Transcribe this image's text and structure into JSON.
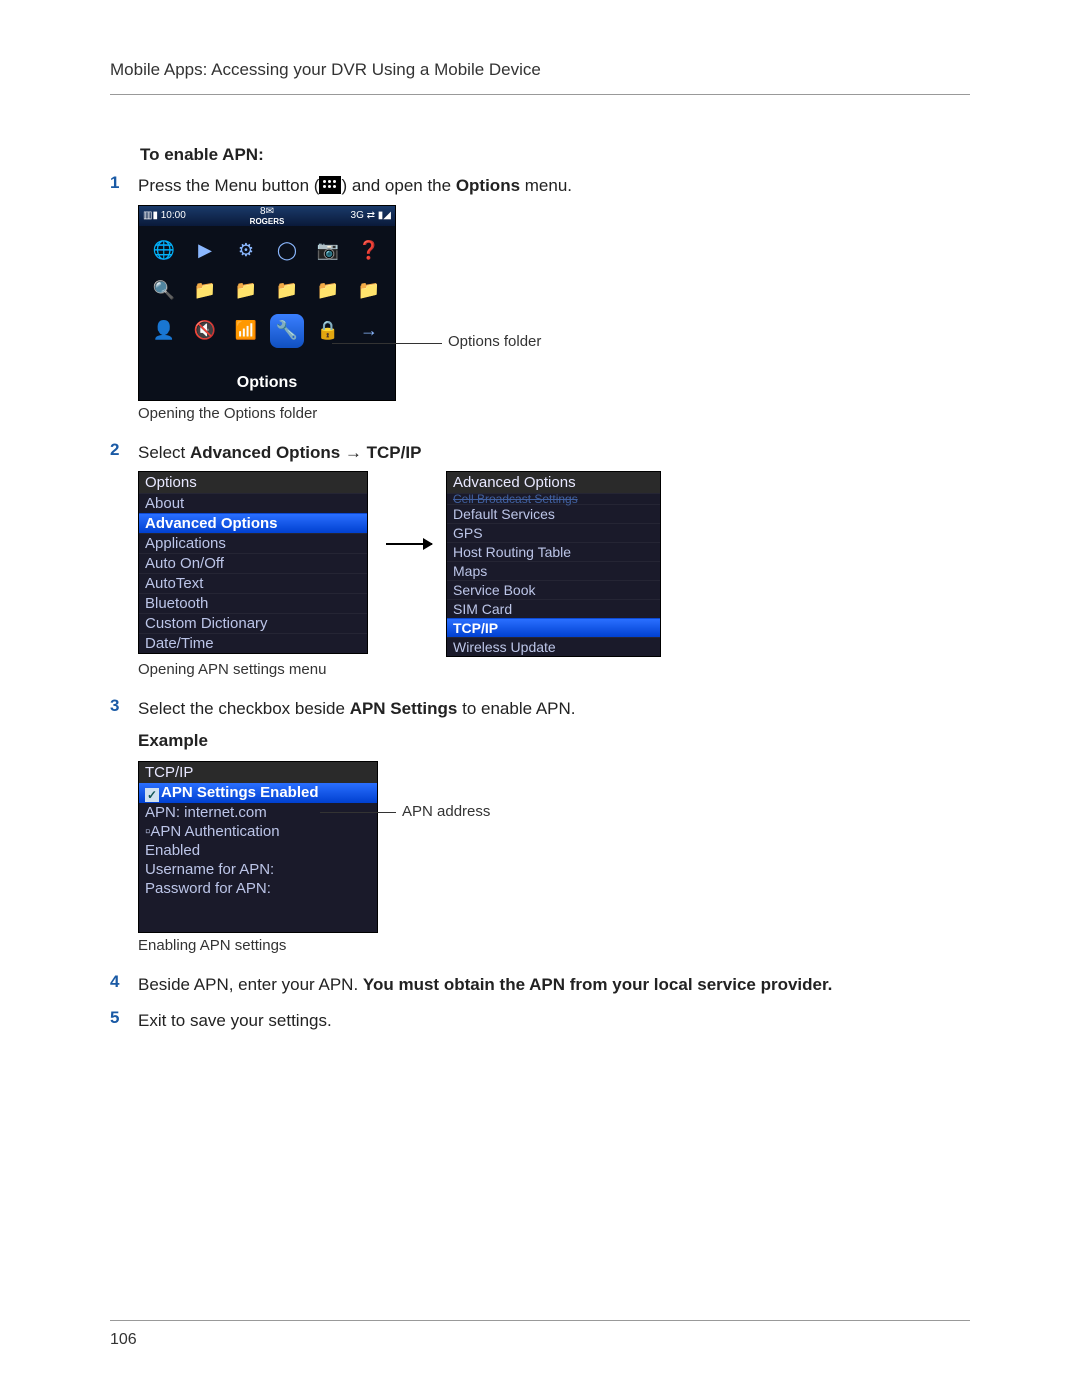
{
  "header": "Mobile Apps: Accessing your DVR Using a Mobile Device",
  "section_title": "To enable APN:",
  "step1": {
    "num": "1",
    "text_before": "Press the Menu button (",
    "text_after": ") and open the ",
    "bold": "Options",
    "text_end": " menu."
  },
  "fig1": {
    "status": {
      "left": "▥▮   10:00",
      "mid_top": "8✉",
      "mid_bold": "ROGERS",
      "right": "3G ⇄ ▮◢"
    },
    "icons": [
      "🌐",
      "▶",
      "⚙",
      "◯",
      "📷",
      "❓",
      "🔍",
      "📁",
      "📁",
      "📁",
      "📁",
      "📁",
      "👤",
      "🔇",
      "📶",
      "🔧",
      "🔒",
      "→"
    ],
    "selected_index": 15,
    "label": "Options",
    "leader_label": "Options folder",
    "caption": "Opening the Options folder"
  },
  "step2": {
    "num": "2",
    "text_before": "Select ",
    "bold1": "Advanced Options",
    "arrow": " → ",
    "bold2": "TCP/IP"
  },
  "fig2": {
    "left": {
      "header": "Options",
      "rows": [
        "About",
        "Advanced Options",
        "Applications",
        "Auto On/Off",
        "AutoText",
        "Bluetooth",
        "Custom Dictionary",
        "Date/Time"
      ],
      "selected_index": 1
    },
    "right": {
      "header": "Advanced Options",
      "cut_row": "Cell Broadcast Settings",
      "rows": [
        "Default Services",
        "GPS",
        "Host Routing Table",
        "Maps",
        "Service Book",
        "SIM Card",
        "TCP/IP",
        "Wireless Update"
      ],
      "selected_index": 6
    },
    "caption": "Opening APN settings menu"
  },
  "step3": {
    "num": "3",
    "text_before": "Select the checkbox beside ",
    "bold": "APN Settings",
    "text_after": " to enable APN."
  },
  "fig3": {
    "example_label": "Example",
    "header": "TCP/IP",
    "row_sel": "APN Settings Enabled",
    "rows": [
      "APN: internet.com",
      "▫APN Authentication",
      "  Enabled",
      "Username for APN:",
      "Password for APN:"
    ],
    "leader_label": "APN address",
    "caption": "Enabling APN settings"
  },
  "step4": {
    "num": "4",
    "text_before": "Beside APN, enter your APN. ",
    "bold": "You must obtain the APN from your local service provider."
  },
  "step5": {
    "num": "5",
    "text": "Exit to save your settings."
  },
  "page_number": "106"
}
